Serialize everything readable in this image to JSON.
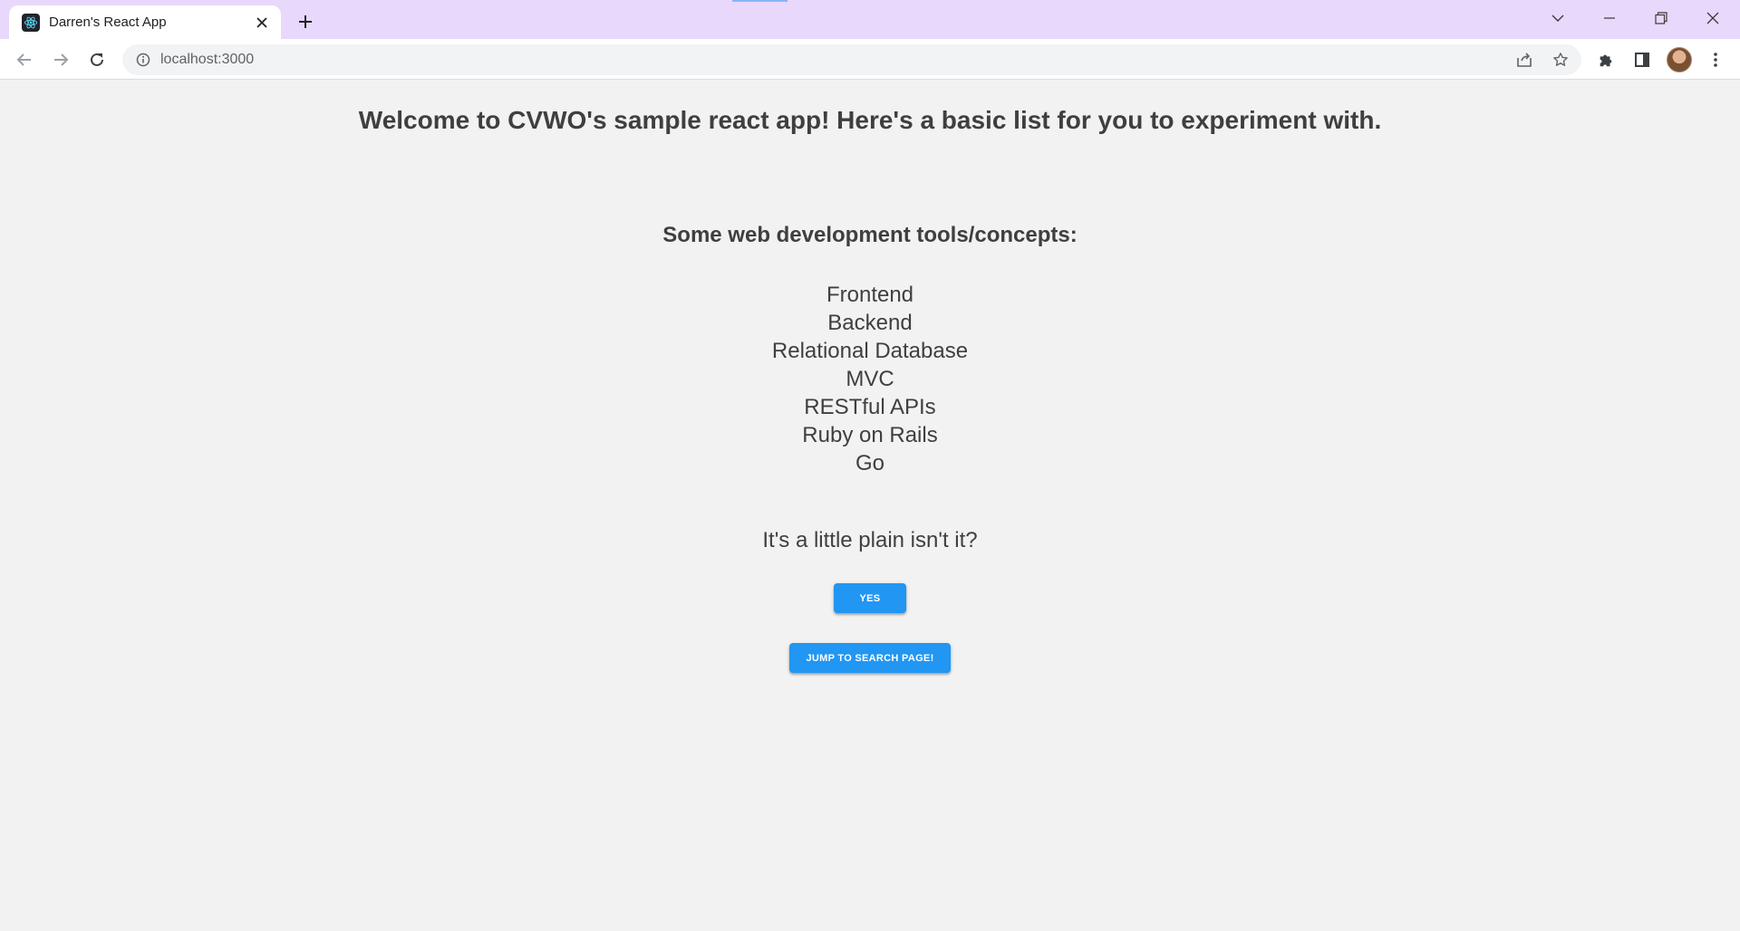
{
  "browser": {
    "tab_title": "Darren's React App",
    "url": "localhost:3000",
    "icons": {
      "favicon": "react-logo-icon",
      "tab_close": "close-icon",
      "new_tab": "plus-icon",
      "tab_search": "chevron-down-icon",
      "minimize": "minimize-icon",
      "restore": "restore-icon",
      "close_window": "close-icon",
      "back": "arrow-left-icon",
      "forward": "arrow-right-icon",
      "reload": "reload-icon",
      "site_info": "info-icon",
      "share": "share-icon",
      "bookmark": "star-icon",
      "extensions": "puzzle-icon",
      "side_panel": "side-panel-icon",
      "menu": "kebab-menu-icon"
    },
    "colors": {
      "tabstrip_bg": "#e8d8fb",
      "accent": "#8ab4f8"
    }
  },
  "page": {
    "welcome": "Welcome to CVWO's sample react app! Here's a basic list for you to experiment with.",
    "subheading": "Some web development tools/concepts:",
    "tools": [
      "Frontend",
      "Backend",
      "Relational Database",
      "MVC",
      "RESTful APIs",
      "Ruby on Rails",
      "Go"
    ],
    "question": "It's a little plain isn't it?",
    "yes_button": "Yes",
    "search_button": "Jump to search page!",
    "colors": {
      "background": "#f2f2f2",
      "text": "#3f3f3f",
      "button": "#2196f3"
    }
  }
}
